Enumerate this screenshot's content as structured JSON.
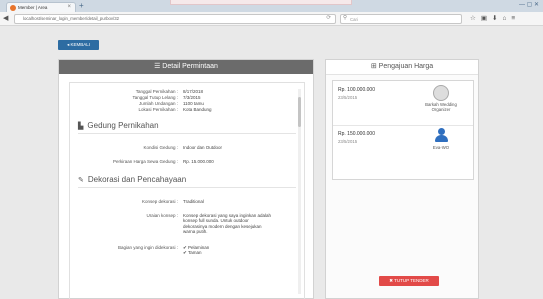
{
  "browser": {
    "tab_title": "Member | Area",
    "tab_close": "×",
    "new_tab": "+",
    "url": "localhost/seminar_login_member/detail_purbov/32",
    "search_placeholder": "Cari",
    "window_controls": "— ▢ ✕",
    "icons": [
      "star-icon",
      "bookmarks-icon",
      "download-icon",
      "home-icon",
      "menu-icon"
    ]
  },
  "back_button": "◂ KEMBALI",
  "detail": {
    "title": "Detail Permintaan",
    "fields": [
      {
        "label": "Tanggal Pernikahan :",
        "value": "8/17/2018"
      },
      {
        "label": "Tanggal Tutup Lelang :",
        "value": "7/3/2015"
      },
      {
        "label": "Jumlah Undangan :",
        "value": "1100 tamu"
      },
      {
        "label": "Lokasi Pernikahan :",
        "value": "Kota Bandung"
      }
    ],
    "section_gedung": "Gedung Pernikahan",
    "kondisi_label": "Kondisi Gedung :",
    "kondisi_value": "Indoor dan Outdoor",
    "harga_label": "Perkiraan Harga Sewa Gedung :",
    "harga_value": "Rp. 15.000.000",
    "section_dekorasi": "Dekorasi dan Pencahayaan",
    "konsep_label": "Konsep dekorasi :",
    "konsep_value": "Traditional",
    "uraian_label": "Uraian konsep :",
    "uraian_lines": [
      "Konsep dekorasi yang saya inginkan adalah",
      "konsep full sunda. Untuk outdoor",
      "dekorasinya modern dengan kesejukan",
      "warna putih."
    ],
    "bagian_label": "Bagian yang ingin didekorasi :",
    "bagian_items": [
      "✔ Pelaminan",
      "✔ Taman"
    ]
  },
  "pengajuan": {
    "title": "Pengajuan Harga",
    "offers": [
      {
        "price": "Rp. 100.000.000",
        "date": "23/5/2015",
        "name_line1": "Barkah Wedding",
        "name_line2": "Organizer"
      },
      {
        "price": "Rp. 150.000.000",
        "date": "23/5/2015",
        "name_line1": "Eva-WO",
        "name_line2": ""
      }
    ],
    "close_button": "✖ TUTUP TENDER"
  },
  "colors": {
    "accent": "#2d6ca2",
    "header": "#6b6b6b",
    "danger": "#e24a48",
    "avatar": "#2f6fbf"
  }
}
